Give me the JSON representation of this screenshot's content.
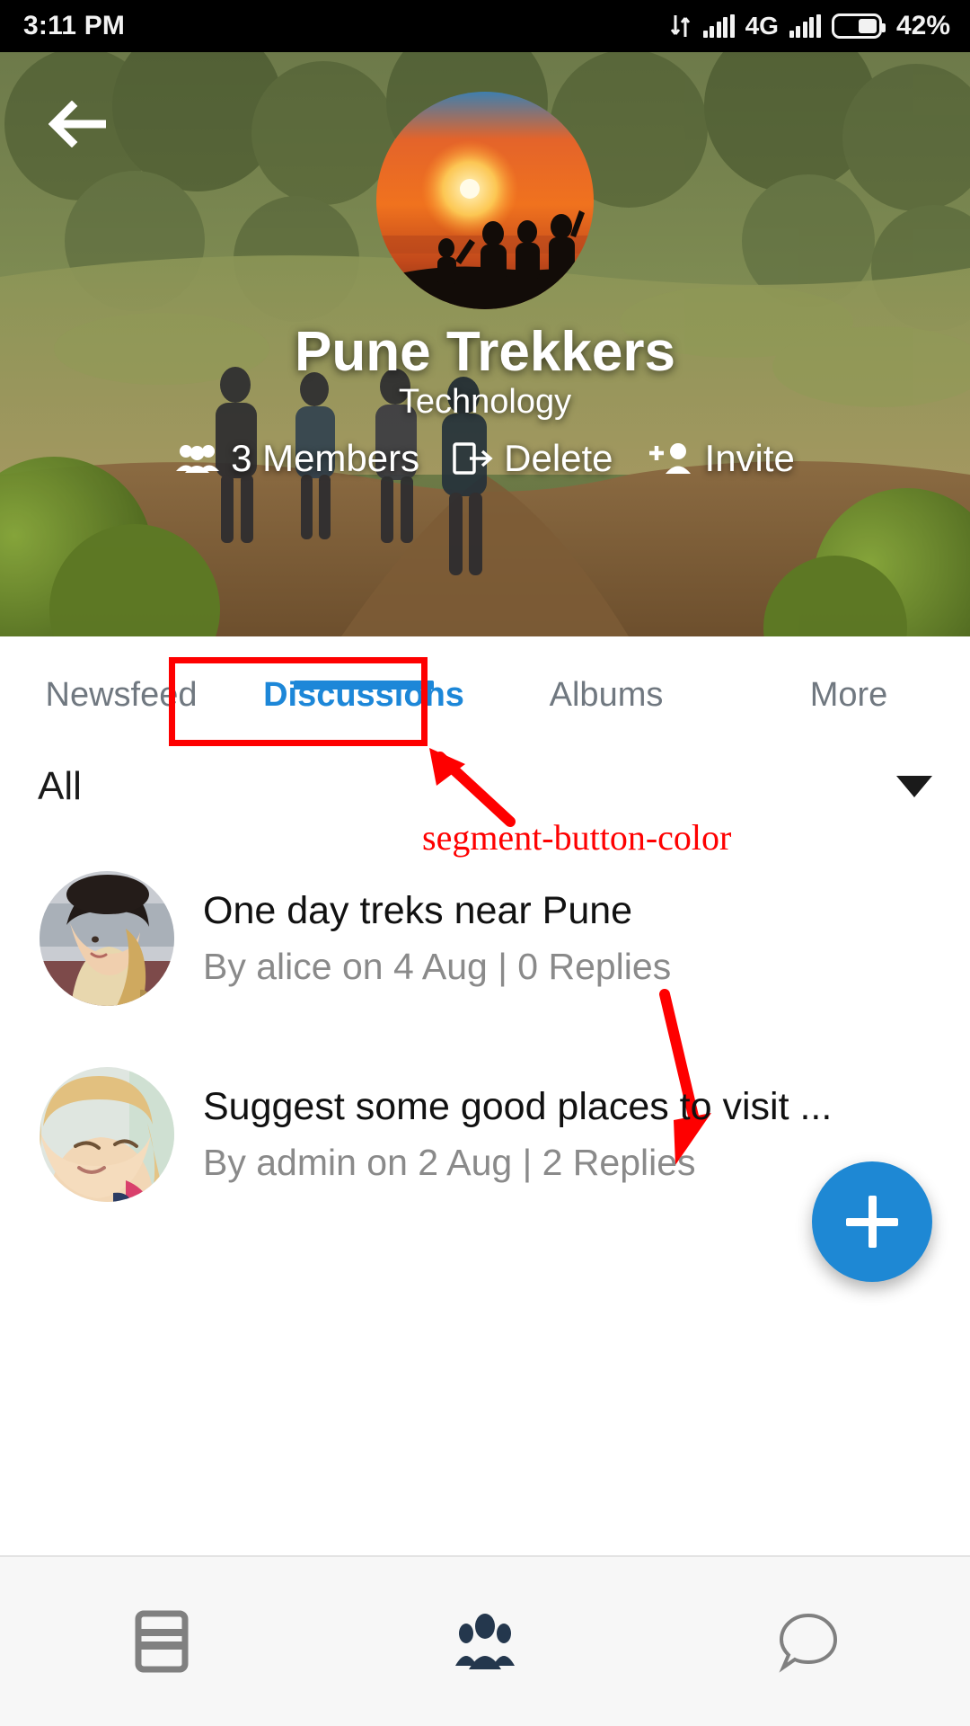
{
  "status_bar": {
    "time": "3:11 PM",
    "network_type": "4G",
    "battery_percent": "42%",
    "icons": [
      "data-transfer-icon",
      "signal-icon",
      "signal-icon",
      "battery-icon"
    ]
  },
  "header": {
    "back_icon": "back-arrow-icon",
    "group_avatar_alt": "group-avatar",
    "title": "Pune Trekkers",
    "category": "Technology",
    "actions": [
      {
        "icon": "members-icon",
        "label": "3 Members"
      },
      {
        "icon": "delete-exit-icon",
        "label": "Delete"
      },
      {
        "icon": "invite-person-icon",
        "label": "Invite"
      }
    ]
  },
  "tabs": {
    "items": [
      {
        "label": "Newsfeed",
        "active": false
      },
      {
        "label": "Discussions",
        "active": true
      },
      {
        "label": "Albums",
        "active": false
      },
      {
        "label": "More",
        "active": false
      }
    ],
    "active_color": "#1d87d8",
    "inactive_color": "#707880"
  },
  "filter": {
    "selected": "All",
    "caret_icon": "chevron-down-icon"
  },
  "discussions": [
    {
      "avatar": "user-avatar-alice",
      "title": "One day treks near Pune",
      "meta": "By alice on 4 Aug |  0 Replies"
    },
    {
      "avatar": "user-avatar-admin",
      "title": "Suggest some good places to visit ...",
      "meta": "By admin on 2 Aug |  2 Replies"
    }
  ],
  "fab": {
    "icon": "plus-icon",
    "color": "#1e88d4"
  },
  "bottom_nav": {
    "items": [
      {
        "icon": "feed-card-icon",
        "active": false
      },
      {
        "icon": "groups-people-icon",
        "active": true
      },
      {
        "icon": "chat-bubble-icon",
        "active": false
      }
    ],
    "active_color": "#24374d",
    "inactive_color": "#808080"
  },
  "annotation": {
    "label": "segment-button-color",
    "color": "#fe0000"
  }
}
